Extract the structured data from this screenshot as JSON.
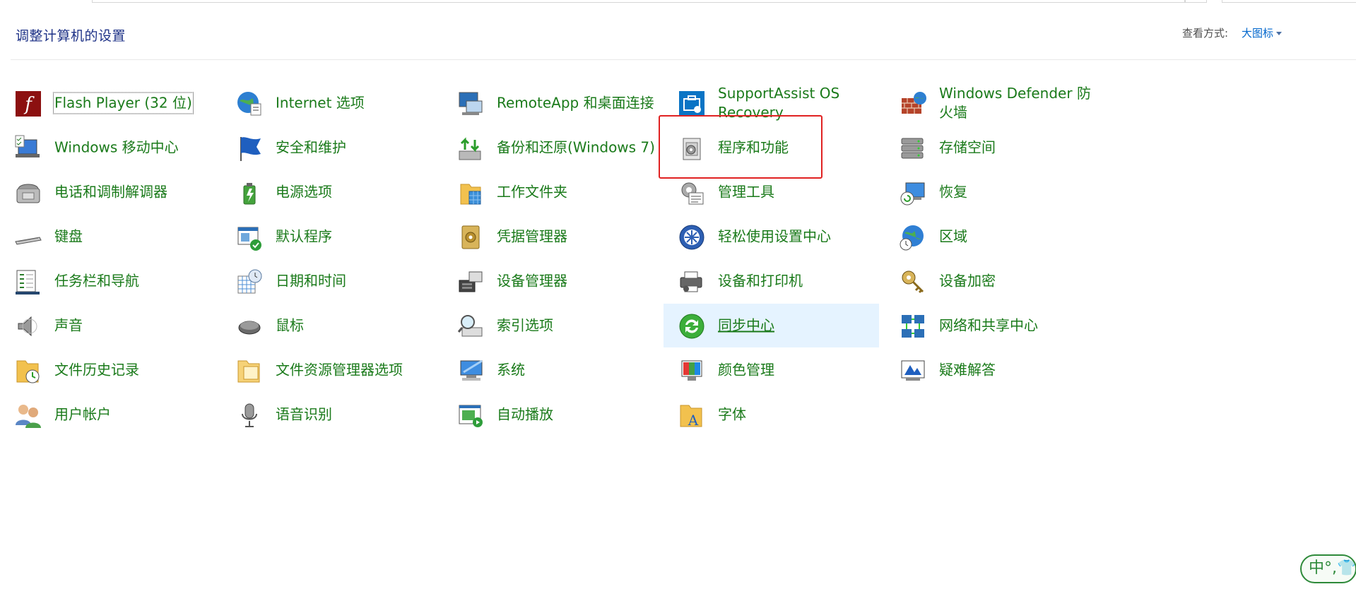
{
  "header": {
    "title": "调整计算机的设置",
    "view_label": "查看方式:",
    "view_value": "大图标"
  },
  "ime": {
    "text": "中°,👕"
  },
  "items": [
    {
      "label": "Flash Player (32 位)",
      "icon": "flash-icon"
    },
    {
      "label": "Internet 选项",
      "icon": "internet-options-icon"
    },
    {
      "label": "RemoteApp 和桌面连接",
      "icon": "remoteapp-icon"
    },
    {
      "label": "SupportAssist OS Recovery",
      "icon": "supportassist-icon"
    },
    {
      "label": "Windows Defender 防火墙",
      "icon": "firewall-icon"
    },
    {
      "label": "Windows 移动中心",
      "icon": "mobility-center-icon"
    },
    {
      "label": "安全和维护",
      "icon": "security-flag-icon"
    },
    {
      "label": "备份和还原(Windows 7)",
      "icon": "backup-icon"
    },
    {
      "label": "程序和功能",
      "icon": "programs-features-icon"
    },
    {
      "label": "存储空间",
      "icon": "storage-spaces-icon"
    },
    {
      "label": "电话和调制解调器",
      "icon": "phone-modem-icon"
    },
    {
      "label": "电源选项",
      "icon": "power-options-icon"
    },
    {
      "label": "工作文件夹",
      "icon": "work-folders-icon"
    },
    {
      "label": "管理工具",
      "icon": "admin-tools-icon"
    },
    {
      "label": "恢复",
      "icon": "recovery-icon"
    },
    {
      "label": "键盘",
      "icon": "keyboard-icon"
    },
    {
      "label": "默认程序",
      "icon": "default-programs-icon"
    },
    {
      "label": "凭据管理器",
      "icon": "credential-manager-icon"
    },
    {
      "label": "轻松使用设置中心",
      "icon": "ease-of-access-icon"
    },
    {
      "label": "区域",
      "icon": "region-icon"
    },
    {
      "label": "任务栏和导航",
      "icon": "taskbar-icon"
    },
    {
      "label": "日期和时间",
      "icon": "date-time-icon"
    },
    {
      "label": "设备管理器",
      "icon": "device-manager-icon"
    },
    {
      "label": "设备和打印机",
      "icon": "devices-printers-icon"
    },
    {
      "label": "设备加密",
      "icon": "device-encryption-icon"
    },
    {
      "label": "声音",
      "icon": "sound-icon"
    },
    {
      "label": "鼠标",
      "icon": "mouse-icon"
    },
    {
      "label": "索引选项",
      "icon": "indexing-icon"
    },
    {
      "label": "同步中心",
      "icon": "sync-center-icon"
    },
    {
      "label": "网络和共享中心",
      "icon": "network-sharing-icon"
    },
    {
      "label": "文件历史记录",
      "icon": "file-history-icon"
    },
    {
      "label": "文件资源管理器选项",
      "icon": "explorer-options-icon"
    },
    {
      "label": "系统",
      "icon": "system-icon"
    },
    {
      "label": "颜色管理",
      "icon": "color-management-icon"
    },
    {
      "label": "疑难解答",
      "icon": "troubleshooting-icon"
    },
    {
      "label": "用户帐户",
      "icon": "user-accounts-icon"
    },
    {
      "label": "语音识别",
      "icon": "speech-recognition-icon"
    },
    {
      "label": "自动播放",
      "icon": "autoplay-icon"
    },
    {
      "label": "字体",
      "icon": "fonts-icon"
    }
  ]
}
